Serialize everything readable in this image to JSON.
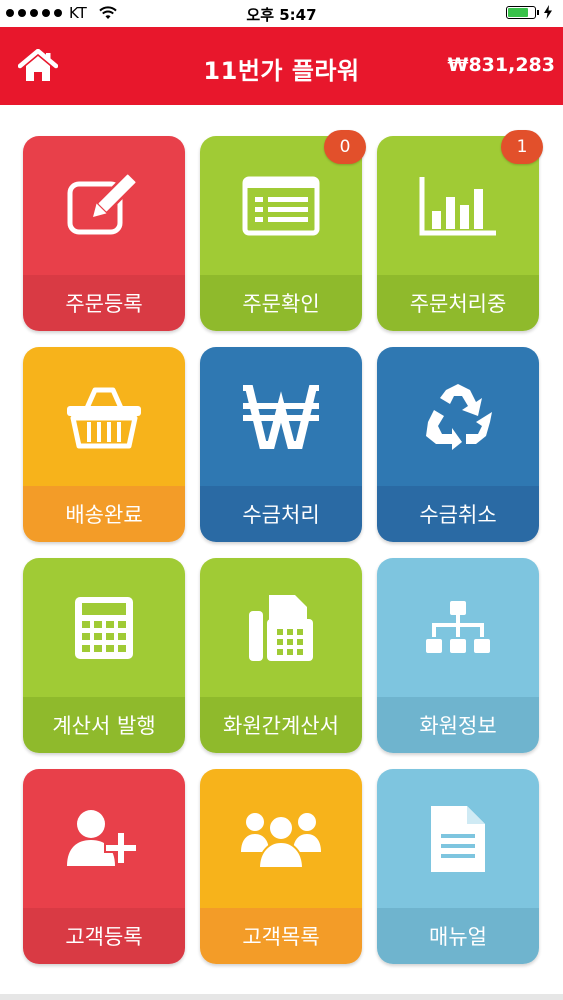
{
  "status_bar": {
    "carrier": "KT",
    "time": "오후 5:47"
  },
  "header": {
    "title": "11번가 플라워",
    "balance": "₩831,283"
  },
  "tiles": [
    {
      "label": "주문등록",
      "icon": "edit-icon",
      "top_color": "#e8404a",
      "bottom_color": "#d93a44"
    },
    {
      "label": "주문확인",
      "icon": "list-icon",
      "top_color": "#a0cb35",
      "bottom_color": "#8fba2c",
      "badge": "0"
    },
    {
      "label": "주문처리중",
      "icon": "bar-chart-icon",
      "top_color": "#a0cb35",
      "bottom_color": "#8fba2c",
      "badge": "1"
    },
    {
      "label": "배송완료",
      "icon": "basket-icon",
      "top_color": "#f7b31b",
      "bottom_color": "#f39c28"
    },
    {
      "label": "수금처리",
      "icon": "won-icon",
      "top_color": "#2f78b2",
      "bottom_color": "#2a6aa4"
    },
    {
      "label": "수금취소",
      "icon": "recycle-icon",
      "top_color": "#2f78b2",
      "bottom_color": "#2a6aa4"
    },
    {
      "label": "계산서 발행",
      "icon": "calculator-icon",
      "top_color": "#a0cb35",
      "bottom_color": "#8fba2c"
    },
    {
      "label": "화원간계산서",
      "icon": "fax-icon",
      "top_color": "#a0cb35",
      "bottom_color": "#8fba2c"
    },
    {
      "label": "화원정보",
      "icon": "sitemap-icon",
      "top_color": "#7ec5df",
      "bottom_color": "#6fb4ce"
    },
    {
      "label": "고객등록",
      "icon": "add-user-icon",
      "top_color": "#e8404a",
      "bottom_color": "#d93a44"
    },
    {
      "label": "고객목록",
      "icon": "group-icon",
      "top_color": "#f7b31b",
      "bottom_color": "#f39c28"
    },
    {
      "label": "매뉴얼",
      "icon": "document-icon",
      "top_color": "#7ec5df",
      "bottom_color": "#6fb4ce"
    }
  ]
}
